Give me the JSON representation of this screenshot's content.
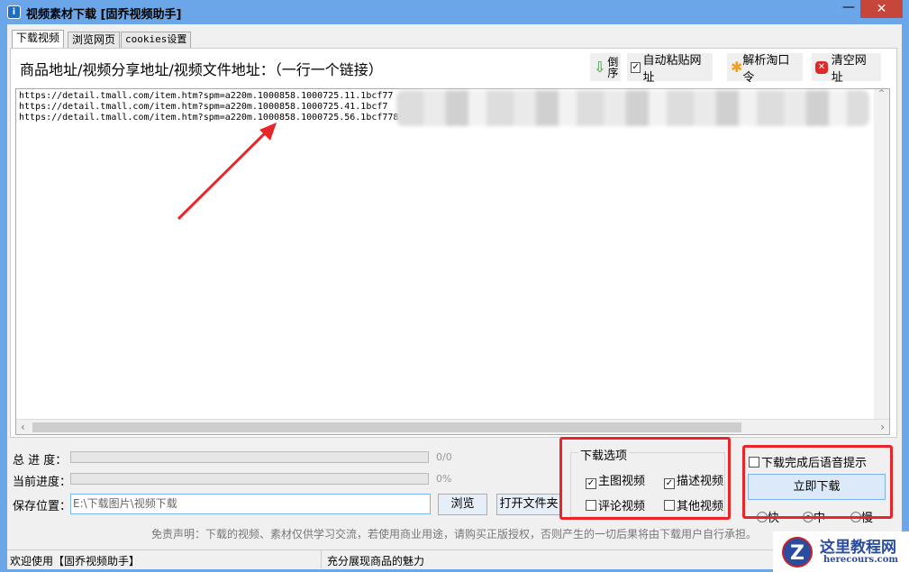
{
  "window": {
    "title": "视频素材下载 [固乔视频助手]",
    "min": "—",
    "close": "✕",
    "app_icon": "i"
  },
  "tabs": [
    {
      "label": "下载视频"
    },
    {
      "label": "浏览网页"
    },
    {
      "label": "cookies设置"
    }
  ],
  "url_label": "商品地址/视频分享地址/视频文件地址：（一行一个链接）",
  "toolbar": {
    "reverse": "倒序",
    "auto_paste": "自动粘贴网址",
    "parse_code": "解析淘口令",
    "clear": "清空网址"
  },
  "urls": [
    "https://detail.tmall.com/item.htm?spm=a220m.1000858.1000725.11.1bcf77",
    "https://detail.tmall.com/item.htm?spm=a220m.1000858.1000725.41.1bcf7",
    "https://detail.tmall.com/item.htm?spm=a220m.1000858.1000725.56.1bcf7789S"
  ],
  "progress": {
    "total_label": "总 进 度：",
    "total_value": "0/0",
    "total_fraction": 0,
    "current_label": "当前进度：",
    "current_value": "0%",
    "current_fraction": 0
  },
  "save": {
    "label": "保存位置：",
    "path": "E:\\下载图片\\视频下载",
    "browse": "浏览",
    "open_folder": "打开文件夹"
  },
  "disclaimer": "免责声明：下载的视频、素材仅供学习交流，若使用商业用途，请购买正版授权，否则产生的一切后果将由下载用户自行承担。",
  "options": {
    "title": "下载选项",
    "main_video": "主图视频",
    "desc_video": "描述视频",
    "comment_video": "评论视频",
    "other_video": "其他视频"
  },
  "download": {
    "voice_prompt": "下载完成后语音提示",
    "start": "立即下载",
    "fast": "快",
    "medium": "中",
    "slow": "慢"
  },
  "status": {
    "left": "欢迎使用【固乔视频助手】",
    "right": "充分展现商品的魅力"
  },
  "watermark": {
    "name": "这里教程网",
    "url": "herecours.com"
  }
}
